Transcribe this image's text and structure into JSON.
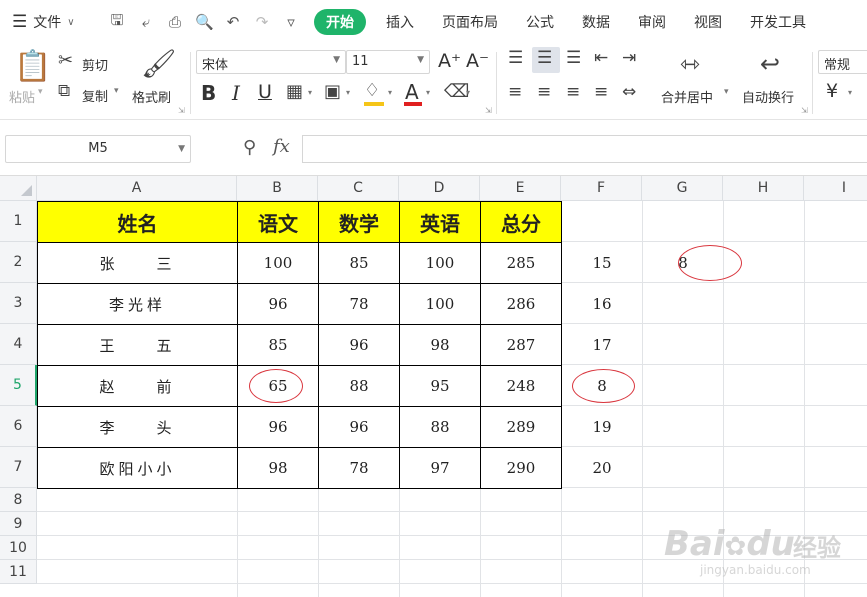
{
  "menubar": {
    "file_label": "文件",
    "tabs": [
      "开始",
      "插入",
      "页面布局",
      "公式",
      "数据",
      "审阅",
      "视图",
      "开发工具"
    ],
    "active_tab": "开始"
  },
  "ribbon": {
    "paste_label": "粘贴",
    "cut_label": "剪切",
    "copy_label": "复制",
    "format_painter_label": "格式刷",
    "font_name": "宋体",
    "font_size": "11",
    "increase_font_glyph": "A⁺",
    "decrease_font_glyph": "A⁻",
    "bold_glyph": "B",
    "italic_glyph": "I",
    "underline_glyph": "U",
    "font_color_glyph": "A",
    "merge_center_label": "合并居中",
    "wrap_text_label": "自动换行",
    "number_format": "常规",
    "currency_glyph": "¥",
    "colors": {
      "accent": "#1fb46a",
      "header_fill": "#ffff00",
      "highlight": "#f5c518",
      "font_color_bar": "#e02020",
      "annotation": "#d9363e"
    }
  },
  "formula_bar": {
    "name_box": "M5",
    "fx_label": "fx",
    "formula": ""
  },
  "sheet": {
    "columns": [
      "A",
      "B",
      "C",
      "D",
      "E",
      "F",
      "G",
      "H",
      "I"
    ],
    "rows": [
      "1",
      "2",
      "3",
      "4",
      "5",
      "6",
      "7",
      "8",
      "9",
      "10",
      "11"
    ],
    "selected_row": "5",
    "table_headers": [
      "姓名",
      "语文",
      "数学",
      "英语",
      "总分"
    ],
    "table_rows": [
      {
        "name": "张　　三",
        "chinese": "100",
        "math": "85",
        "english": "100",
        "total": "285",
        "f": "15"
      },
      {
        "name": "李光样",
        "chinese": "96",
        "math": "78",
        "english": "100",
        "total": "286",
        "f": "16"
      },
      {
        "name": "王　　五",
        "chinese": "85",
        "math": "96",
        "english": "98",
        "total": "287",
        "f": "17"
      },
      {
        "name": "赵　　前",
        "chinese": "65",
        "math": "88",
        "english": "95",
        "total": "248",
        "f": "8"
      },
      {
        "name": "李　　头",
        "chinese": "96",
        "math": "96",
        "english": "88",
        "total": "289",
        "f": "19"
      },
      {
        "name": "欧阳小小",
        "chinese": "98",
        "math": "78",
        "english": "97",
        "total": "290",
        "f": "20"
      }
    ],
    "g2_value": "8"
  },
  "watermark": {
    "brand": "Bai",
    "brand_suffix": "du",
    "product": "经验",
    "url": "jingyan.baidu.com"
  }
}
